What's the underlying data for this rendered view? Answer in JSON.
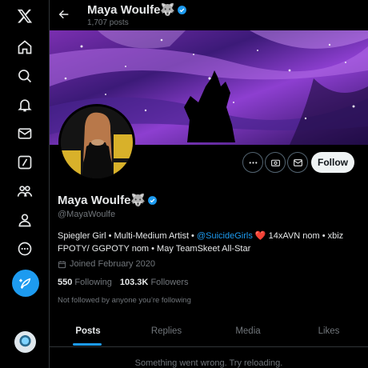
{
  "header": {
    "name": "Maya Woulfe",
    "emoji": "🐺",
    "posts_count": "1,707 posts"
  },
  "profile": {
    "name": "Maya Woulfe",
    "emoji": "🐺",
    "handle": "@MayaWoulfe",
    "bio_part1": "Spiegler Girl • Multi-Medium Artist • ",
    "bio_mention": "@SuicideGirls",
    "bio_heart": "❤️",
    "bio_part2": " 14xAVN nom • xbiz FPOTY/ GGPOTY nom • May TeamSkeet All-Star",
    "joined": "Joined February 2020",
    "following_count": "550",
    "following_label": "Following",
    "followers_count": "103.3K",
    "followers_label": "Followers",
    "not_followed_note": "Not followed by anyone you’re following"
  },
  "actions": {
    "follow_label": "Follow"
  },
  "tabs": [
    {
      "label": "Posts",
      "active": true
    },
    {
      "label": "Replies",
      "active": false
    },
    {
      "label": "Media",
      "active": false
    },
    {
      "label": "Likes",
      "active": false
    }
  ],
  "feed": {
    "error_message": "Something went wrong. Try reloading."
  },
  "nav": [
    {
      "name": "x-logo-icon"
    },
    {
      "name": "home-icon"
    },
    {
      "name": "search-icon"
    },
    {
      "name": "notifications-bell-icon"
    },
    {
      "name": "messages-envelope-icon"
    },
    {
      "name": "grok-icon"
    },
    {
      "name": "communities-icon"
    },
    {
      "name": "profile-icon"
    },
    {
      "name": "more-circle-icon"
    }
  ],
  "colors": {
    "accent": "#1d9bf0",
    "background": "#000000",
    "muted_text": "#71767b",
    "follow_button_bg": "#eff3f4"
  }
}
